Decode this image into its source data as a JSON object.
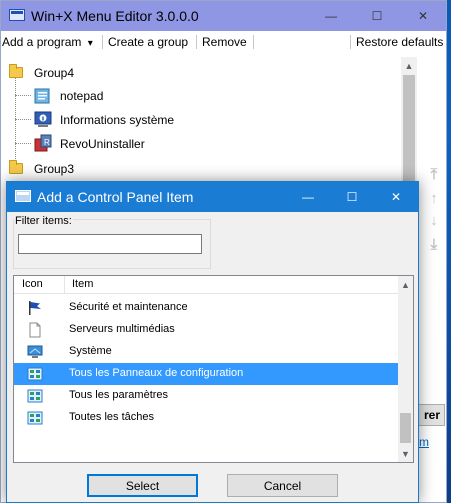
{
  "main_window": {
    "title": "Win+X Menu Editor 3.0.0.0",
    "controls": {
      "minimize": "—",
      "maximize": "☐",
      "close": "✕"
    }
  },
  "menubar": {
    "add_program": "Add a program",
    "add_program_arrow": "▾",
    "create_group": "Create a group",
    "remove": "Remove",
    "restore_defaults": "Restore defaults"
  },
  "tree": {
    "group4": "Group4",
    "items": [
      {
        "label": "notepad",
        "icon": "notepad-icon"
      },
      {
        "label": "Informations système",
        "icon": "system-info-icon"
      },
      {
        "label": "RevoUninstaller",
        "icon": "revo-uninstaller-icon"
      }
    ],
    "group3": "Group3"
  },
  "side_arrows": [
    "⤒",
    "↑",
    "↓",
    "⤓"
  ],
  "peek": {
    "button_text": "rer",
    "link_text": "m"
  },
  "dialog": {
    "title": "Add a Control Panel Item",
    "controls": {
      "minimize": "—",
      "maximize": "☐",
      "close": "✕"
    },
    "filter_label": "Filter items:",
    "filter_value": "",
    "columns": {
      "icon": "Icon",
      "item": "Item"
    },
    "items": [
      {
        "label": "Sécurité et maintenance",
        "icon": "flag-icon",
        "selected": false
      },
      {
        "label": "Serveurs multimédias",
        "icon": "document-icon",
        "selected": false
      },
      {
        "label": "Système",
        "icon": "monitor-icon",
        "selected": false
      },
      {
        "label": "Tous les Panneaux de configuration",
        "icon": "control-panel-icon",
        "selected": true
      },
      {
        "label": "Tous les paramètres",
        "icon": "control-panel-icon",
        "selected": false
      },
      {
        "label": "Toutes les tâches",
        "icon": "control-panel-icon",
        "selected": false
      }
    ],
    "select_button": "Select",
    "cancel_button": "Cancel"
  },
  "colors": {
    "main_titlebar": "#8f97e4",
    "dialog_titlebar": "#1b7cd3",
    "selection": "#3399ff",
    "folder": "#f5c94a"
  }
}
